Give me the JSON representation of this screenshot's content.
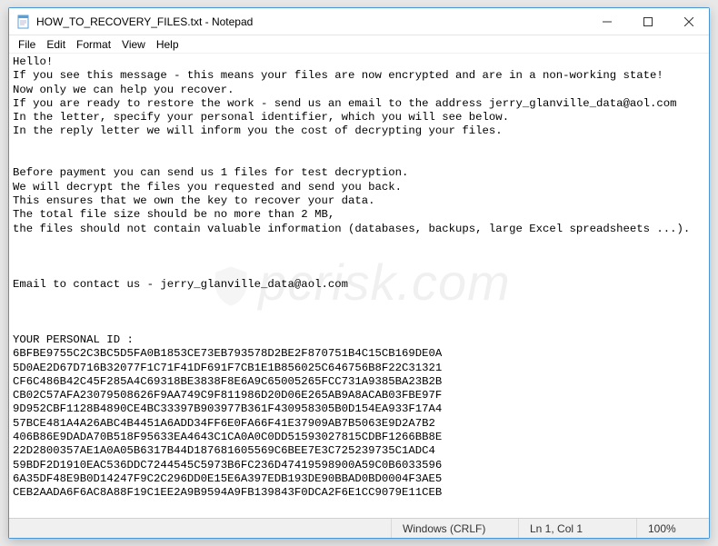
{
  "title": "HOW_TO_RECOVERY_FILES.txt - Notepad",
  "menu": {
    "file": "File",
    "edit": "Edit",
    "format": "Format",
    "view": "View",
    "help": "Help"
  },
  "body": "Hello!\nIf you see this message - this means your files are now encrypted and are in a non-working state!\nNow only we can help you recover.\nIf you are ready to restore the work - send us an email to the address jerry_glanville_data@aol.com\nIn the letter, specify your personal identifier, which you will see below.\nIn the reply letter we will inform you the cost of decrypting your files.\n\n\nBefore payment you can send us 1 files for test decryption.\nWe will decrypt the files you requested and send you back.\nThis ensures that we own the key to recover your data.\nThe total file size should be no more than 2 MB,\nthe files should not contain valuable information (databases, backups, large Excel spreadsheets ...).\n\n\n\nEmail to contact us - jerry_glanville_data@aol.com\n\n\n\nYOUR PERSONAL ID :\n6BFBE9755C2C3BC5D5FA0B1853CE73EB793578D2BE2F870751B4C15CB169DE0A\n5D0AE2D67D716B32077F1C71F41DF691F7CB1E1B856025C646756B8F22C31321\nCF6C486B42C45F285A4C69318BE3838F8E6A9C65005265FCC731A9385BA23B2B\nCB02C57AFA23079508626F9AA749C9F811986D20D06E265AB9A8ACAB03FBE97F\n9D952CBF1128B4890CE4BC33397B903977B361F430958305B0D154EA933F17A4\n57BCE481A4A26ABC4B4451A6ADD34FF6E0FA66F41E37909AB7B5063E9D2A7B2\n406B86E9DADA70B518F95633EA4643C1CA0A0C0DD51593027815CDBF1266BB8E\n22D2800357AE1A0A05B6317B44D187681605569C6BEE7E3C725239735C1ADC4\n59BDF2D1910EAC536DDC7244545C5973B6FC236D47419598900A59C0B6033596\n6A35DF48E9B0D14247F9C2C296DD0E15E6A397EDB193DE90BBAD0BD0004F3AE5\nCEB2AADA6F6AC8A88F19C1EE2A9B9594A9FB139843F0DCA2F6E1CC9079E11CEB",
  "status": {
    "encoding": "Windows (CRLF)",
    "position": "Ln 1, Col 1",
    "zoom": "100%"
  },
  "watermark": "pcrisk.com"
}
